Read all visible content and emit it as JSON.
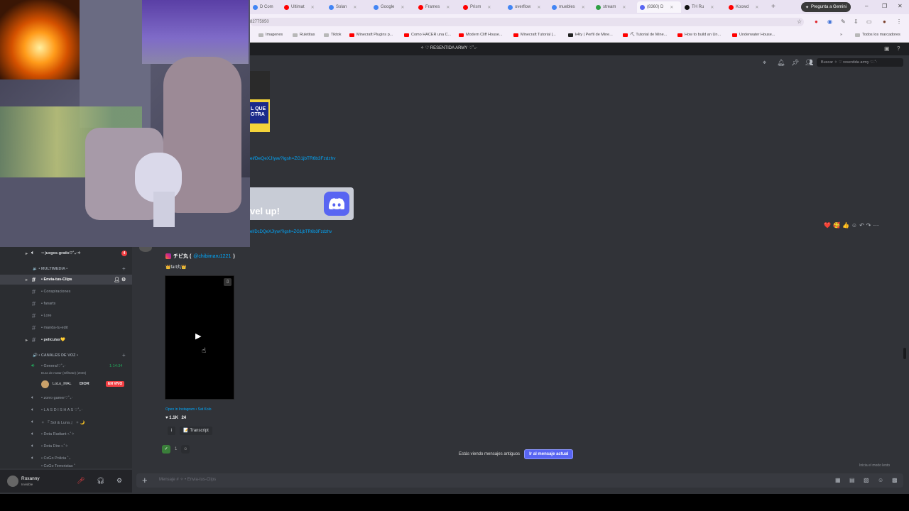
{
  "browser": {
    "tabs": [
      {
        "label": "D Com",
        "color": "#4285f4"
      },
      {
        "label": "Ultimat",
        "color": "#ff0000"
      },
      {
        "label": "Solan",
        "color": "#4285f4"
      },
      {
        "label": "Google",
        "color": "#4285f4"
      },
      {
        "label": "Frames",
        "color": "#ff0000"
      },
      {
        "label": "Prism",
        "color": "#ff0000"
      },
      {
        "label": "overflow",
        "color": "#4285f4"
      },
      {
        "label": "muebles",
        "color": "#4285f4"
      },
      {
        "label": "stream",
        "color": "#2ea043"
      },
      {
        "label": "(8360) D",
        "color": "#5865f2"
      },
      {
        "label": "TH Ru",
        "color": "#111111"
      },
      {
        "label": "Koowd",
        "color": "#ff0000"
      }
    ],
    "gemini_label": "Pregunta a Gemini",
    "url_text": "82775950",
    "bookmarks": [
      {
        "label": "Imagenes",
        "color": "#b8b8b8"
      },
      {
        "label": "Ruletitas",
        "color": "#b8b8b8"
      },
      {
        "label": "Tiktok",
        "color": "#b8b8b8"
      },
      {
        "label": "Minecraft Plugins p...",
        "color": "#ff0000"
      },
      {
        "label": "Como HACER una C...",
        "color": "#ff0000"
      },
      {
        "label": "Modern Cliff House...",
        "color": "#ff0000"
      },
      {
        "label": "Minecraft Tutorial |...",
        "color": "#ff0000"
      },
      {
        "label": "k4ty | Perfil de Mine...",
        "color": "#222222"
      },
      {
        "label": "⛏ Tutorial de Mine...",
        "color": "#ff0000"
      },
      {
        "label": "How to build an Un...",
        "color": "#ff0000"
      },
      {
        "label": "Underwater House...",
        "color": "#ff0000"
      }
    ],
    "all_bookmarks": "Todos los marcadores"
  },
  "discord": {
    "server_name": "✧ ♡ RESENTIDA ARMY ♡˚₊‧",
    "search_placeholder": "Buscar ✧ ♡ resentida army ♡.˚‧",
    "thumb_text": "L QUE\nOTRA",
    "link1": "el/DeQeXJIyw/?igsh=ZG1jbTR6b3Fzdzhv",
    "embed_text": "vel up!",
    "link2": "el/DcDQeXJIyw/?igsh=ZG1jbTR6b3Fzdzhv",
    "reactions_hover": [
      "❤️",
      "🥰",
      "👍"
    ],
    "notice_text": "Estás viendo mensajes antiguos",
    "jump_label": "Ir al mensaje actual",
    "slowmode": "Inicia el modo lento",
    "composer_placeholder": "Mensaje # ✧ • Envia-tus-Clips",
    "post": {
      "title": "チビ丸 (",
      "handle": "@chibimaru1221",
      "close": ")",
      "subtitle": "👑fart丸👑",
      "open_link": "Open in Instagram • Sat Kolo",
      "stats": "♥ 1.1K    24",
      "info_label": "i",
      "transcript_label": "📝 Transcript",
      "react_count": "1"
    },
    "channels": {
      "cat_multimedia": "🔉 • MULTIMEDIA •",
      "cat_voice": "🔊 • CANALES DE VOZ •",
      "top": "‧• juegos-gratis♡˚₊‧✧",
      "top_badge": "4",
      "items": [
        "• Envia-tus-Clips",
        "• Conspiraciones",
        "• fanarts",
        "• Lore",
        "• manda-tu-edit",
        "• peliculas💛"
      ],
      "voice_general": "• General♡˚₊‧",
      "voice_time": "1:14:34",
      "voice_sub": "Dura de matar (Infiltrate) (2026)",
      "voice_user": "LoLo_MAL",
      "voice_user_tag": "DIOR",
      "live_label": "EN VIVO",
      "voice_others": [
        "• zorro gamer♡˚₊‧",
        "• L A S D I S H A S ♡˚₊‧",
        "✧ 『 Sol & Luna 』 ✧ 🌙",
        "• Dota Radiant •.˚✧",
        "• Dota Dire •.˚✧",
        "• CsGo Policia ˚₊",
        "• CsGo Terroristas ˚"
      ]
    },
    "user": {
      "name": "Roxanny",
      "status": "Invisible"
    }
  }
}
